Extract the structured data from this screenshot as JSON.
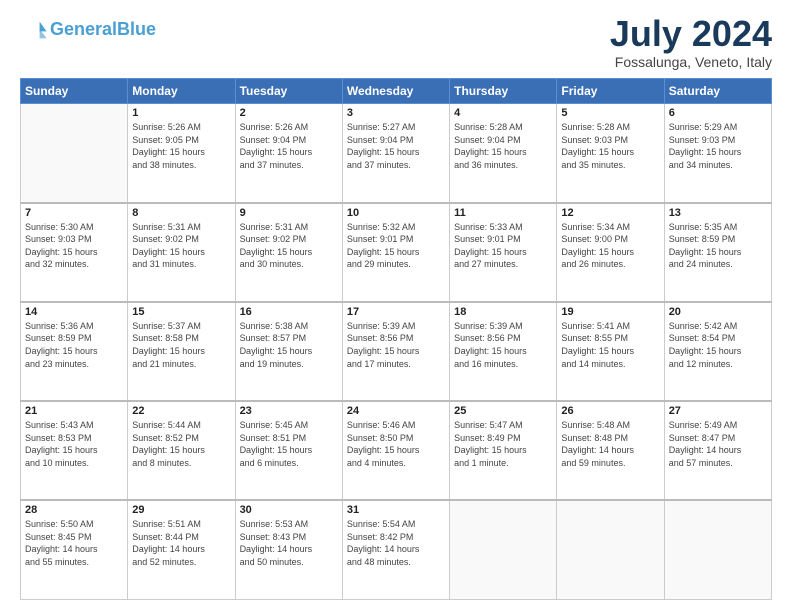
{
  "header": {
    "logo_line1": "General",
    "logo_line2": "Blue",
    "month_year": "July 2024",
    "location": "Fossalunga, Veneto, Italy"
  },
  "days_of_week": [
    "Sunday",
    "Monday",
    "Tuesday",
    "Wednesday",
    "Thursday",
    "Friday",
    "Saturday"
  ],
  "weeks": [
    [
      {
        "day": "",
        "info": ""
      },
      {
        "day": "1",
        "info": "Sunrise: 5:26 AM\nSunset: 9:05 PM\nDaylight: 15 hours\nand 38 minutes."
      },
      {
        "day": "2",
        "info": "Sunrise: 5:26 AM\nSunset: 9:04 PM\nDaylight: 15 hours\nand 37 minutes."
      },
      {
        "day": "3",
        "info": "Sunrise: 5:27 AM\nSunset: 9:04 PM\nDaylight: 15 hours\nand 37 minutes."
      },
      {
        "day": "4",
        "info": "Sunrise: 5:28 AM\nSunset: 9:04 PM\nDaylight: 15 hours\nand 36 minutes."
      },
      {
        "day": "5",
        "info": "Sunrise: 5:28 AM\nSunset: 9:03 PM\nDaylight: 15 hours\nand 35 minutes."
      },
      {
        "day": "6",
        "info": "Sunrise: 5:29 AM\nSunset: 9:03 PM\nDaylight: 15 hours\nand 34 minutes."
      }
    ],
    [
      {
        "day": "7",
        "info": "Sunrise: 5:30 AM\nSunset: 9:03 PM\nDaylight: 15 hours\nand 32 minutes."
      },
      {
        "day": "8",
        "info": "Sunrise: 5:31 AM\nSunset: 9:02 PM\nDaylight: 15 hours\nand 31 minutes."
      },
      {
        "day": "9",
        "info": "Sunrise: 5:31 AM\nSunset: 9:02 PM\nDaylight: 15 hours\nand 30 minutes."
      },
      {
        "day": "10",
        "info": "Sunrise: 5:32 AM\nSunset: 9:01 PM\nDaylight: 15 hours\nand 29 minutes."
      },
      {
        "day": "11",
        "info": "Sunrise: 5:33 AM\nSunset: 9:01 PM\nDaylight: 15 hours\nand 27 minutes."
      },
      {
        "day": "12",
        "info": "Sunrise: 5:34 AM\nSunset: 9:00 PM\nDaylight: 15 hours\nand 26 minutes."
      },
      {
        "day": "13",
        "info": "Sunrise: 5:35 AM\nSunset: 8:59 PM\nDaylight: 15 hours\nand 24 minutes."
      }
    ],
    [
      {
        "day": "14",
        "info": "Sunrise: 5:36 AM\nSunset: 8:59 PM\nDaylight: 15 hours\nand 23 minutes."
      },
      {
        "day": "15",
        "info": "Sunrise: 5:37 AM\nSunset: 8:58 PM\nDaylight: 15 hours\nand 21 minutes."
      },
      {
        "day": "16",
        "info": "Sunrise: 5:38 AM\nSunset: 8:57 PM\nDaylight: 15 hours\nand 19 minutes."
      },
      {
        "day": "17",
        "info": "Sunrise: 5:39 AM\nSunset: 8:56 PM\nDaylight: 15 hours\nand 17 minutes."
      },
      {
        "day": "18",
        "info": "Sunrise: 5:39 AM\nSunset: 8:56 PM\nDaylight: 15 hours\nand 16 minutes."
      },
      {
        "day": "19",
        "info": "Sunrise: 5:41 AM\nSunset: 8:55 PM\nDaylight: 15 hours\nand 14 minutes."
      },
      {
        "day": "20",
        "info": "Sunrise: 5:42 AM\nSunset: 8:54 PM\nDaylight: 15 hours\nand 12 minutes."
      }
    ],
    [
      {
        "day": "21",
        "info": "Sunrise: 5:43 AM\nSunset: 8:53 PM\nDaylight: 15 hours\nand 10 minutes."
      },
      {
        "day": "22",
        "info": "Sunrise: 5:44 AM\nSunset: 8:52 PM\nDaylight: 15 hours\nand 8 minutes."
      },
      {
        "day": "23",
        "info": "Sunrise: 5:45 AM\nSunset: 8:51 PM\nDaylight: 15 hours\nand 6 minutes."
      },
      {
        "day": "24",
        "info": "Sunrise: 5:46 AM\nSunset: 8:50 PM\nDaylight: 15 hours\nand 4 minutes."
      },
      {
        "day": "25",
        "info": "Sunrise: 5:47 AM\nSunset: 8:49 PM\nDaylight: 15 hours\nand 1 minute."
      },
      {
        "day": "26",
        "info": "Sunrise: 5:48 AM\nSunset: 8:48 PM\nDaylight: 14 hours\nand 59 minutes."
      },
      {
        "day": "27",
        "info": "Sunrise: 5:49 AM\nSunset: 8:47 PM\nDaylight: 14 hours\nand 57 minutes."
      }
    ],
    [
      {
        "day": "28",
        "info": "Sunrise: 5:50 AM\nSunset: 8:45 PM\nDaylight: 14 hours\nand 55 minutes."
      },
      {
        "day": "29",
        "info": "Sunrise: 5:51 AM\nSunset: 8:44 PM\nDaylight: 14 hours\nand 52 minutes."
      },
      {
        "day": "30",
        "info": "Sunrise: 5:53 AM\nSunset: 8:43 PM\nDaylight: 14 hours\nand 50 minutes."
      },
      {
        "day": "31",
        "info": "Sunrise: 5:54 AM\nSunset: 8:42 PM\nDaylight: 14 hours\nand 48 minutes."
      },
      {
        "day": "",
        "info": ""
      },
      {
        "day": "",
        "info": ""
      },
      {
        "day": "",
        "info": ""
      }
    ]
  ]
}
